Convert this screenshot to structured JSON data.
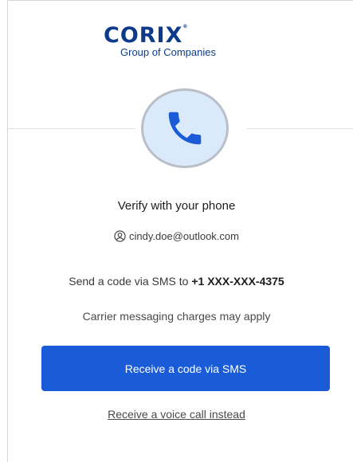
{
  "brand": {
    "logo_word": "corix",
    "logo_tm": "®",
    "logo_subtitle": "Group of Companies",
    "color": "#0d3b8a"
  },
  "header_icon": {
    "icon": "phone-icon",
    "circle_fill": "#dbeafb",
    "icon_color": "#1a5cd7"
  },
  "title": "Verify with your phone",
  "user": {
    "icon": "user-circle-icon",
    "email": "cindy.doe@outlook.com"
  },
  "sms_prompt": {
    "prefix": "Send a code via SMS to",
    "phone": "+1 XXX-XXX-4375"
  },
  "carrier_note": "Carrier messaging charges may apply",
  "primary_button": {
    "label": "Receive a code via SMS",
    "color": "#1a5cd7"
  },
  "secondary_link": {
    "label": "Receive a voice call instead"
  }
}
